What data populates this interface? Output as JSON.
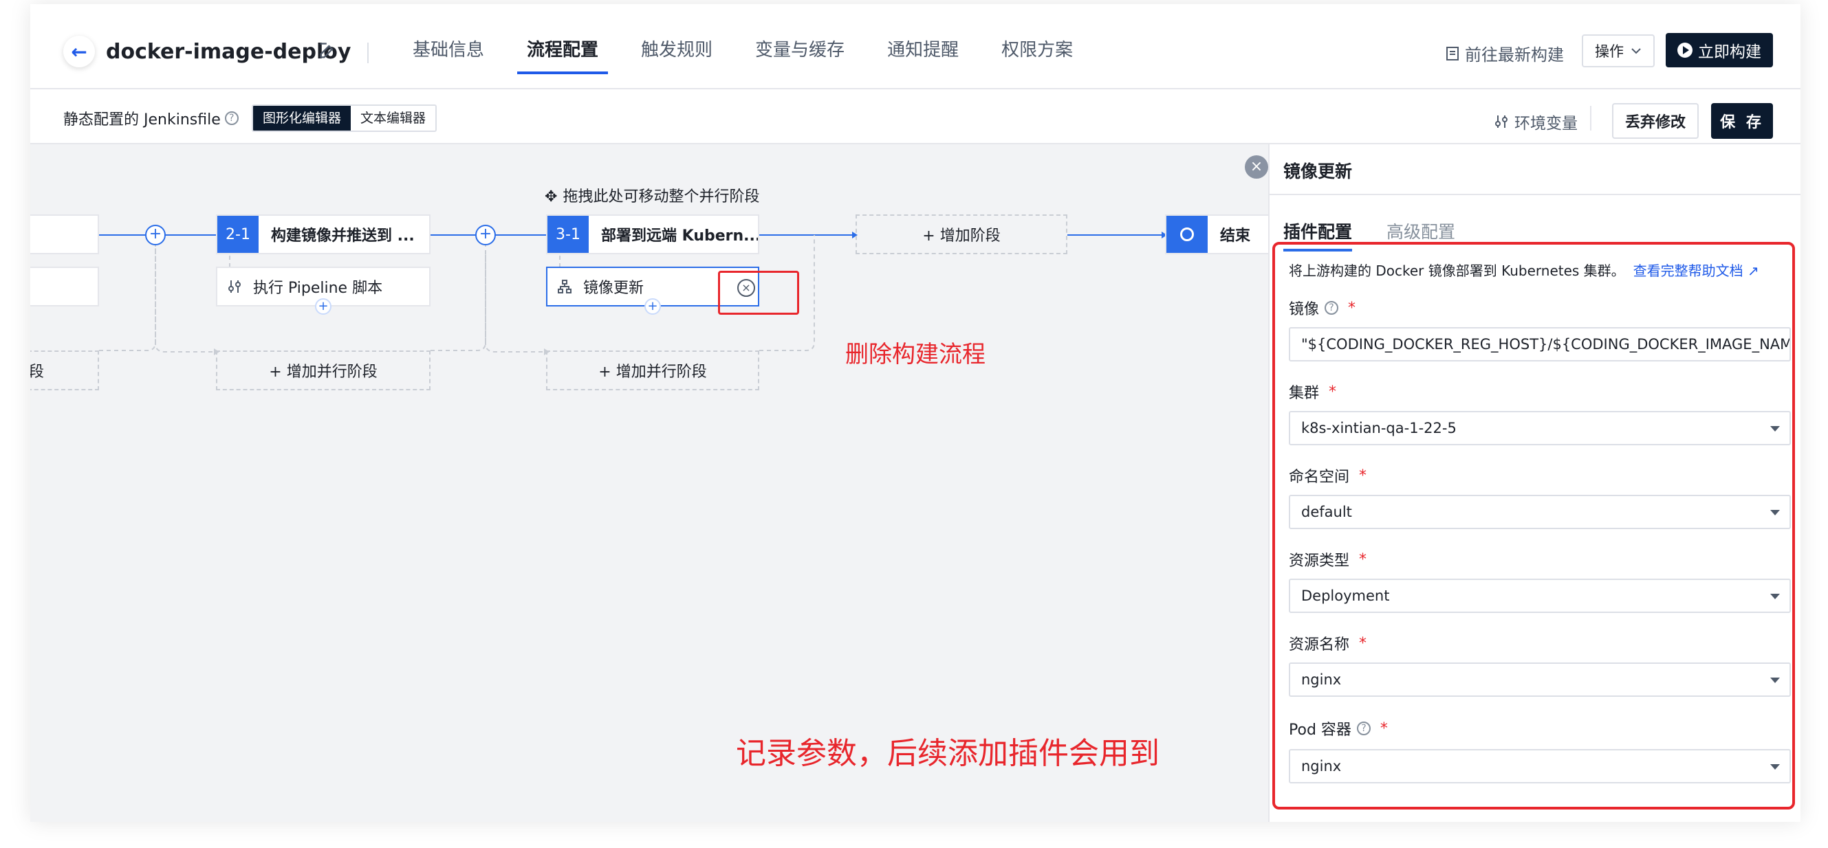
{
  "header": {
    "title": "docker-image-deploy",
    "tabs": [
      "基础信息",
      "流程配置",
      "触发规则",
      "变量与缓存",
      "通知提醒",
      "权限方案"
    ],
    "active_tab": "流程配置",
    "goto_latest": "前往最新构建",
    "ops_label": "操作",
    "build_label": "立即构建"
  },
  "subheader": {
    "static_label": "静态配置的 Jenkinsfile",
    "editor_graph": "图形化编辑器",
    "editor_text": "文本编辑器",
    "env_var": "环境变量",
    "discard": "丢弃修改",
    "save": "保 存"
  },
  "canvas": {
    "drag_hint": "拖拽此处可移动整个并行阶段",
    "partial_left_text": "段",
    "stage2_num": "2-1",
    "stage2_label": "构建镜像并推送到 ...",
    "stage2_step": "执行 Pipeline 脚本",
    "stage3_num": "3-1",
    "stage3_label": "部署到远端 Kubern...",
    "stage3_step": "镜像更新",
    "add_parallel": "+ 增加并行阶段",
    "add_stage": "+ 增加阶段",
    "end_label": "结束",
    "annotation_delete": "删除构建流程",
    "annotation_record": "记录参数，后续添加插件会用到"
  },
  "panel": {
    "title": "镜像更新",
    "tab_plugin": "插件配置",
    "tab_advanced": "高级配置",
    "desc": "将上游构建的 Docker 镜像部署到 Kubernetes 集群。",
    "help_link": "查看完整帮助文档",
    "fields": [
      {
        "label": "镜像",
        "value": "\"${CODING_DOCKER_REG_HOST}/${CODING_DOCKER_IMAGE_NAM"
      },
      {
        "label": "集群",
        "value": "k8s-xintian-qa-1-22-5"
      },
      {
        "label": "命名空间",
        "value": "default"
      },
      {
        "label": "资源类型",
        "value": "Deployment"
      },
      {
        "label": "资源名称",
        "value": "nginx"
      },
      {
        "label": "Pod 容器",
        "value": "nginx"
      }
    ]
  },
  "colors": {
    "accent": "#2b6de8",
    "dark": "#0b1a2e",
    "annotation": "#e8262c"
  }
}
